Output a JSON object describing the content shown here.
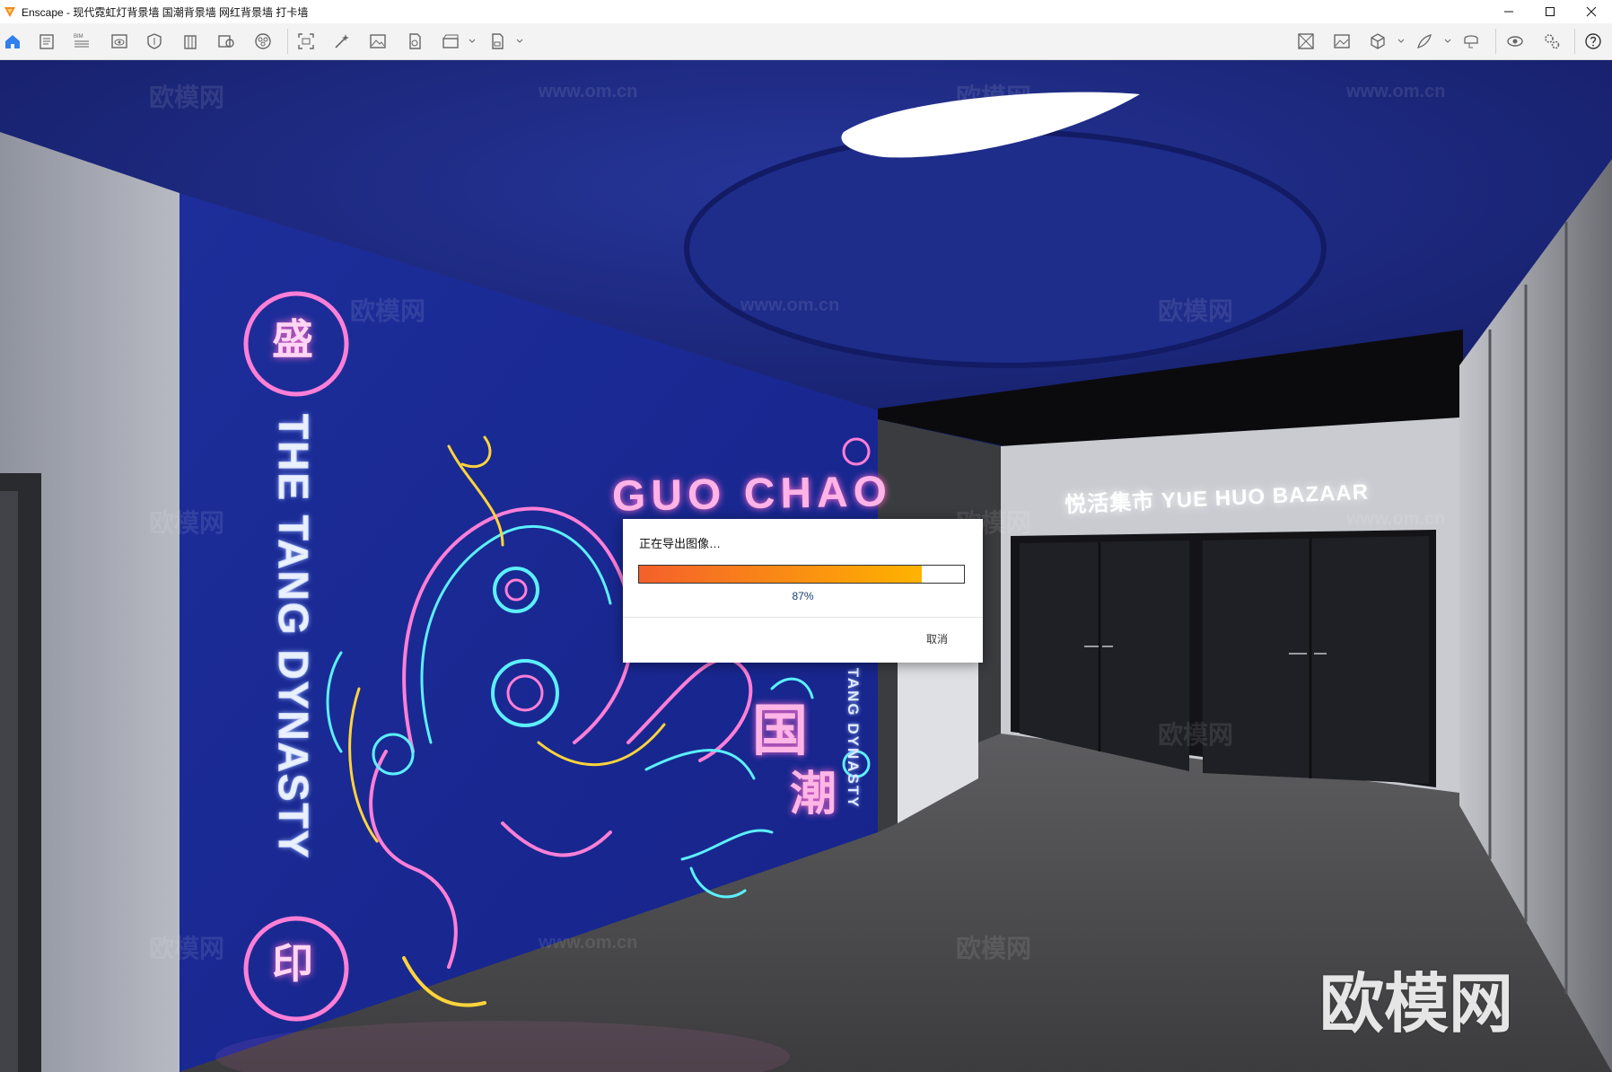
{
  "window": {
    "app_name": "Enscape",
    "title": "Enscape - 现代霓虹灯背景墙 国潮背景墙 网红背景墙 打卡墙",
    "controls": [
      "minimize-icon",
      "maximize-icon",
      "close-icon"
    ]
  },
  "toolbar": {
    "left_icons": [
      "home-icon",
      "asset-library-icon",
      "bim-icon",
      "view-icon",
      "safe-frame-icon",
      "building-icon",
      "material-editor-icon",
      "atmosphere-icon",
      "capture-icon",
      "render-icon",
      "image-export-icon",
      "panorama-icon",
      "video-editor-icon",
      "batch-export-icon"
    ],
    "bim_label": "BIM",
    "right_icons": [
      "orthographic-icon",
      "screenshot-icon",
      "cube-view-icon",
      "paint-icon",
      "vr-headset-icon",
      "visual-settings-icon",
      "general-settings-icon",
      "help-icon"
    ]
  },
  "scene": {
    "sign_text": "悦活集市 YUE HUO BAZAAR",
    "wall_vertical_text": "THE TANG DYNASTY",
    "small_vertical_text": "THE TANG DYNASTY",
    "guochao_text": "GUO CHAO",
    "seal_top": "盛",
    "seal_bottom": "印",
    "guo_char": "国",
    "chao_char": "潮",
    "watermarks": [
      "欧模网",
      "www.om.cn"
    ],
    "watermark_big": "欧模网"
  },
  "export_dialog": {
    "title": "正在导出图像…",
    "progress": 0.87,
    "progress_label": "87%",
    "cancel_label": "取消",
    "bar_colors": [
      "#f4602b",
      "#ffb300"
    ]
  }
}
